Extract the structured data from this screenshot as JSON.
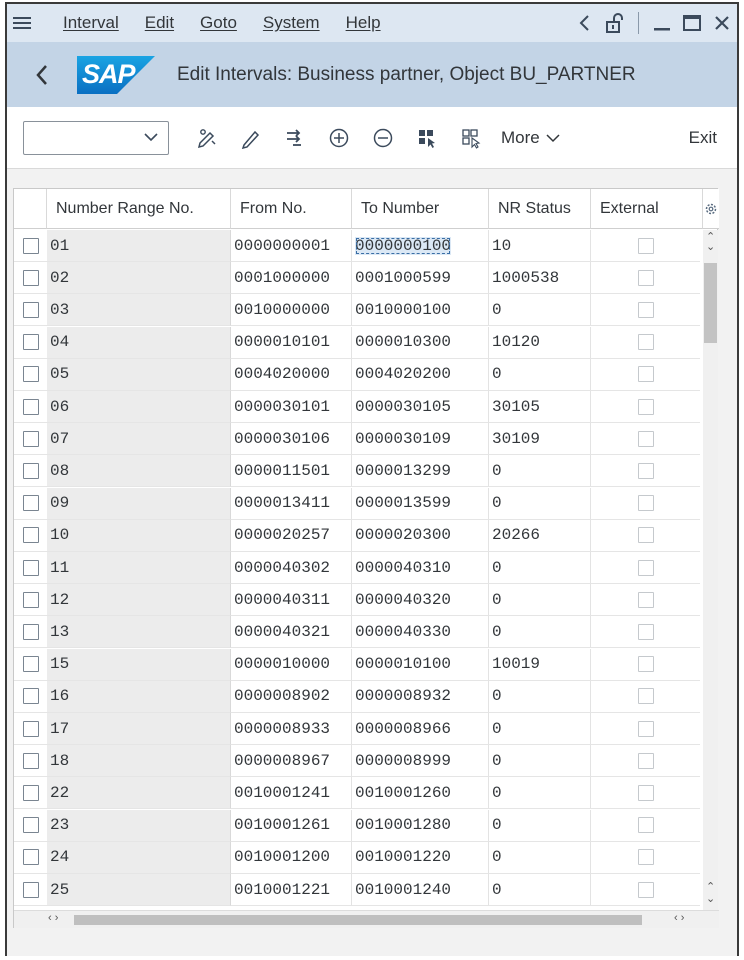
{
  "menu": {
    "items": [
      "Interval",
      "Edit",
      "Goto",
      "System",
      "Help"
    ]
  },
  "window": {
    "title": "Edit Intervals: Business partner, Object BU_PARTNER"
  },
  "toolbar": {
    "dropdown_value": "",
    "more_label": "More",
    "exit_label": "Exit"
  },
  "table": {
    "headers": {
      "nr": "Number Range No.",
      "from": "From No.",
      "to": "To Number",
      "status": "NR Status",
      "external": "External"
    },
    "rows": [
      {
        "nr": "01",
        "from": "0000000001",
        "to": "0000000100",
        "status": "10"
      },
      {
        "nr": "02",
        "from": "0001000000",
        "to": "0001000599",
        "status": "1000538"
      },
      {
        "nr": "03",
        "from": "0010000000",
        "to": "0010000100",
        "status": "0"
      },
      {
        "nr": "04",
        "from": "0000010101",
        "to": "0000010300",
        "status": "10120"
      },
      {
        "nr": "05",
        "from": "0004020000",
        "to": "0004020200",
        "status": "0"
      },
      {
        "nr": "06",
        "from": "0000030101",
        "to": "0000030105",
        "status": "30105"
      },
      {
        "nr": "07",
        "from": "0000030106",
        "to": "0000030109",
        "status": "30109"
      },
      {
        "nr": "08",
        "from": "0000011501",
        "to": "0000013299",
        "status": "0"
      },
      {
        "nr": "09",
        "from": "0000013411",
        "to": "0000013599",
        "status": "0"
      },
      {
        "nr": "10",
        "from": "0000020257",
        "to": "0000020300",
        "status": "20266"
      },
      {
        "nr": "11",
        "from": "0000040302",
        "to": "0000040310",
        "status": "0"
      },
      {
        "nr": "12",
        "from": "0000040311",
        "to": "0000040320",
        "status": "0"
      },
      {
        "nr": "13",
        "from": "0000040321",
        "to": "0000040330",
        "status": "0"
      },
      {
        "nr": "15",
        "from": "0000010000",
        "to": "0000010100",
        "status": "10019"
      },
      {
        "nr": "16",
        "from": "0000008902",
        "to": "0000008932",
        "status": "0"
      },
      {
        "nr": "17",
        "from": "0000008933",
        "to": "0000008966",
        "status": "0"
      },
      {
        "nr": "18",
        "from": "0000008967",
        "to": "0000008999",
        "status": "0"
      },
      {
        "nr": "22",
        "from": "0010001241",
        "to": "0010001260",
        "status": "0"
      },
      {
        "nr": "23",
        "from": "0010001261",
        "to": "0010001280",
        "status": "0"
      },
      {
        "nr": "24",
        "from": "0010001200",
        "to": "0010001220",
        "status": "0"
      },
      {
        "nr": "25",
        "from": "0010001221",
        "to": "0010001240",
        "status": "0"
      }
    ]
  }
}
